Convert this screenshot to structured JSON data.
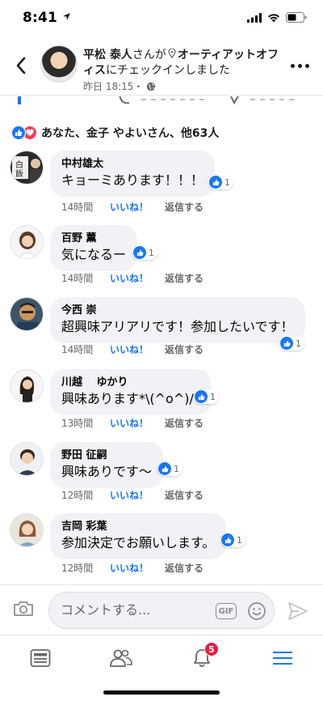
{
  "status_bar": {
    "time": "8:41"
  },
  "post": {
    "author": "平松 泰人",
    "verb1": "さんが",
    "place": "オーティアットオフィス",
    "verb2": "にチェックインしました",
    "timestamp": "昨日 18:15・",
    "privacy_icon": "globe-icon"
  },
  "reactions": {
    "summary": "あなた、金子 やよいさん、他63人",
    "types": [
      "like",
      "love"
    ]
  },
  "actions": {
    "like": "いいね！",
    "reply": "返信する"
  },
  "comments": [
    {
      "name": "中村雄太",
      "text": "キョーミあります！！！",
      "time": "14時間",
      "likes": "1"
    },
    {
      "name": "百野 薫",
      "text": "気になるー",
      "time": "14時間",
      "likes": "1"
    },
    {
      "name": "今西 崇",
      "text": "超興味アリアリです！参加したいです！",
      "time": "14時間",
      "likes": "1"
    },
    {
      "name": "川越　 ゆかり",
      "text": "興味あります*\\(^o^)/*",
      "time": "13時間",
      "likes": "1"
    },
    {
      "name": "野田 征嗣",
      "text": "興味ありです〜",
      "time": "12時間",
      "likes": "1"
    },
    {
      "name": "吉岡 彩葉",
      "text": "参加決定でお願いします。",
      "time": "12時間",
      "likes": "1"
    }
  ],
  "composer": {
    "placeholder": "コメントする...",
    "gif_label": "GIF"
  },
  "nav": {
    "notifications_badge": "5"
  },
  "colors": {
    "accent": "#1877f2",
    "love": "#f33e58",
    "badge": "#e41e3f",
    "bubble": "#f0f2f5"
  }
}
